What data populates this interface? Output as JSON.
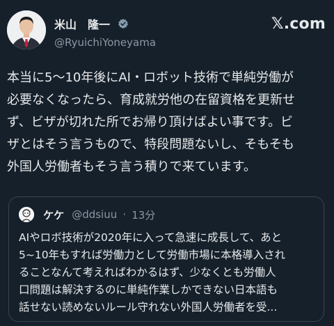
{
  "author": {
    "display_name": "米山　隆一",
    "handle": "@RyuichiYoneyama",
    "avatar": "avatar-photo",
    "verified_icon": "verified-badge-icon"
  },
  "brand": {
    "label": "𝕏.com",
    "icon": "x-logo"
  },
  "tweet": {
    "text": "本当に5～10年後にAI・ロボット技術で単純労働が\n必要なくなったら、育成就労他の在留資格を更新せ\nず、ビザが切れた所でお帰り頂けばよい事です。ビ\nザとはそう言うもので、特段問題ないし、そもそも\n外国人労働者もそう言う積りで来ています。"
  },
  "quote": {
    "display_name": "ケケ",
    "handle": "@ddsiuu",
    "separator": "·",
    "time": "13分",
    "avatar": "sketch-avatar",
    "text": "AIやロボ技術が2020年に入って急速に成長して、あと\n5~10年もすれば労働力として労働市場に本格導入され\nることなんて考えればわかるはず、少なくとも労働人\n口問題は解決するのに単純作業しかできない日本語も\n話せない読めないルール守れない外国人労働者を受..."
  },
  "colors": {
    "background": "#15202b",
    "text": "#e7e9ea",
    "secondary": "#8b98a5",
    "border": "#38444d",
    "verified": "#829aab"
  }
}
